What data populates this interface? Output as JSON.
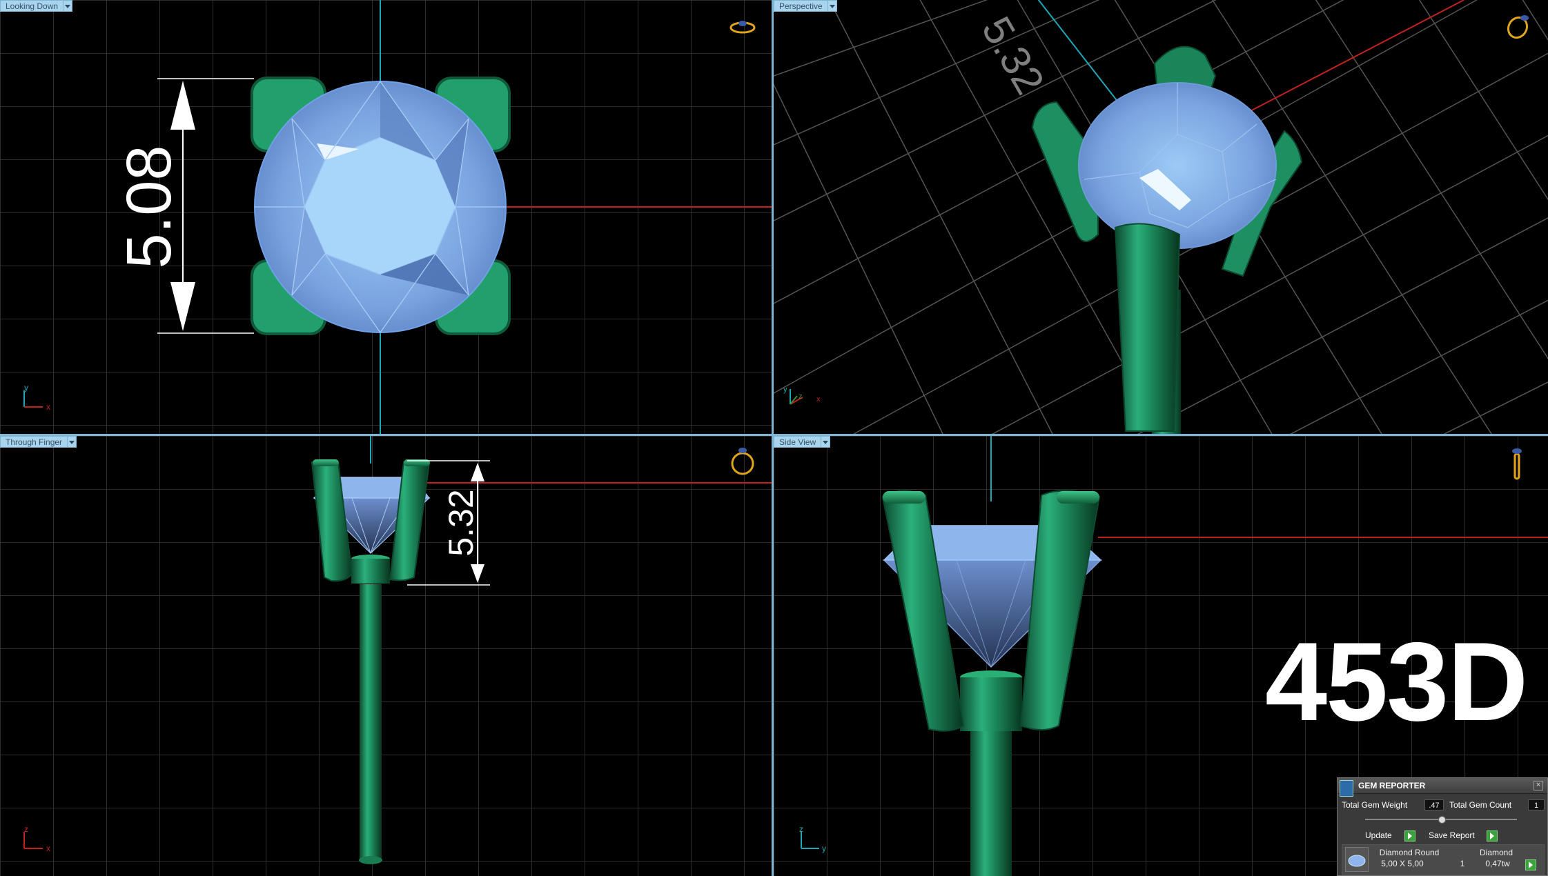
{
  "viewports": {
    "top_left": {
      "label": "Looking Down",
      "dimension": "5.08",
      "axis_x": "x",
      "axis_y": "y"
    },
    "top_right": {
      "label": "Perspective",
      "axis_x": "x",
      "axis_y": "y",
      "axis_z": "z"
    },
    "bottom_left": {
      "label": "Through Finger",
      "dimension": "5.32",
      "axis_x": "x",
      "axis_z": "z"
    },
    "bottom_right": {
      "label": "Side View",
      "axis_y": "y",
      "axis_z": "z"
    }
  },
  "model_code": "453D",
  "gem_reporter": {
    "title": "GEM REPORTER",
    "total_weight_label": "Total Gem Weight",
    "total_weight_value": ".47",
    "total_count_label": "Total Gem Count",
    "total_count_value": "1",
    "update_label": "Update",
    "save_label": "Save Report",
    "gem_name": "Diamond Round",
    "gem_type": "Diamond",
    "gem_size": "5,00 X 5,00",
    "gem_qty": "1",
    "gem_weight": "0,47tw"
  },
  "colors": {
    "metal": "#1e8a5c",
    "stone": "#8fb6ec",
    "axis_x": "#c0221e",
    "axis_y": "#1fa8b8",
    "tab_bg": "#a9d4ee"
  }
}
